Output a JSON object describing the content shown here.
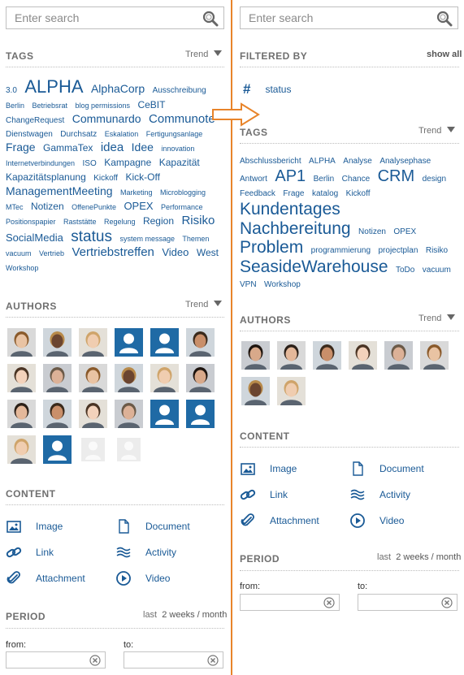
{
  "search": {
    "placeholder": "Enter search"
  },
  "left": {
    "tags_title": "TAGS",
    "trend_label": "Trend",
    "tags": [
      [
        "3.0",
        10
      ],
      [
        "ALPHA",
        22
      ],
      [
        "AlphaCorp",
        14
      ],
      [
        "Ausschreibung",
        10
      ],
      [
        "Berlin",
        9
      ],
      [
        "Betriebsrat",
        9
      ],
      [
        "blog permissions",
        9
      ],
      [
        "CeBIT",
        12
      ],
      [
        "ChangeRequest",
        10
      ],
      [
        "Communardo",
        14
      ],
      [
        "Communote",
        15
      ],
      [
        "Dienstwagen",
        10
      ],
      [
        "Durchsatz",
        10
      ],
      [
        "Eskalation",
        9
      ],
      [
        "Fertigungsanlage",
        9
      ],
      [
        "Frage",
        14
      ],
      [
        "GammaTex",
        12
      ],
      [
        "idea",
        15
      ],
      [
        "Idee",
        14
      ],
      [
        "innovation",
        9
      ],
      [
        "Internetverbindungen",
        9
      ],
      [
        "ISO",
        10
      ],
      [
        "Kampagne",
        12
      ],
      [
        "Kapazität",
        12
      ],
      [
        "Kapazitätsplanung",
        12
      ],
      [
        "Kickoff",
        10
      ],
      [
        "Kick-Off",
        12
      ],
      [
        "ManagementMeeting",
        14
      ],
      [
        "Marketing",
        9
      ],
      [
        "Microblogging",
        9
      ],
      [
        "MTec",
        9
      ],
      [
        "Notizen",
        12
      ],
      [
        "OffenePunkte",
        9
      ],
      [
        "OPEX",
        13
      ],
      [
        "Performance",
        9
      ],
      [
        "Positionspapier",
        9
      ],
      [
        "Raststätte",
        9
      ],
      [
        "Regelung",
        9
      ],
      [
        "Region",
        12
      ],
      [
        "Risiko",
        15
      ],
      [
        "SocialMedia",
        13
      ],
      [
        "status",
        19
      ],
      [
        "system message",
        9
      ],
      [
        "Themen",
        9
      ],
      [
        "vacuum",
        9
      ],
      [
        "Vertrieb",
        9
      ],
      [
        "Vertriebstreffen",
        15
      ],
      [
        "Video",
        13
      ],
      [
        "West",
        12
      ],
      [
        "Workshop",
        9
      ]
    ],
    "authors_title": "AUTHORS",
    "authors_trend": "Trend",
    "authors": [
      "photo",
      "photo",
      "photo",
      "placeholder",
      "placeholder",
      "photo",
      "photo",
      "photo",
      "photo",
      "photo",
      "photo",
      "photo",
      "photo",
      "photo",
      "photo",
      "photo",
      "placeholder",
      "placeholder",
      "photo",
      "placeholder",
      "blank",
      "blank"
    ],
    "content_title": "CONTENT",
    "content": [
      {
        "label": "Image",
        "icon": "image-icon"
      },
      {
        "label": "Document",
        "icon": "document-icon"
      },
      {
        "label": "Link",
        "icon": "link-icon"
      },
      {
        "label": "Activity",
        "icon": "activity-icon"
      },
      {
        "label": "Attachment",
        "icon": "attachment-icon"
      },
      {
        "label": "Video",
        "icon": "video-icon"
      }
    ],
    "period_title": "PERIOD",
    "period_last": "last",
    "period_range": "2 weeks / month",
    "from_label": "from:",
    "to_label": "to:"
  },
  "right": {
    "filtered_title": "FILTERED BY",
    "show_all": "show all",
    "filter_symbol": "#",
    "filter_value": "status",
    "tags_title": "TAGS",
    "trend_label": "Trend",
    "tags": [
      [
        "Abschlussbericht",
        10
      ],
      [
        "ALPHA",
        10
      ],
      [
        "Analyse",
        10
      ],
      [
        "Analysephase",
        10
      ],
      [
        "Antwort",
        10
      ],
      [
        "AP1",
        20
      ],
      [
        "Berlin",
        10
      ],
      [
        "Chance",
        10
      ],
      [
        "CRM",
        20
      ],
      [
        "design",
        10
      ],
      [
        "Feedback",
        10
      ],
      [
        "Frage",
        10
      ],
      [
        "katalog",
        10
      ],
      [
        "Kickoff",
        10
      ],
      [
        "Kundentages",
        21
      ],
      [
        "Nachbereitung",
        21
      ],
      [
        "Notizen",
        10
      ],
      [
        "OPEX",
        10
      ],
      [
        "Problem",
        21
      ],
      [
        "programmierung",
        10
      ],
      [
        "projectplan",
        10
      ],
      [
        "Risiko",
        10
      ],
      [
        "SeasideWarehouse",
        21
      ],
      [
        "ToDo",
        10
      ],
      [
        "vacuum",
        10
      ],
      [
        "VPN",
        10
      ],
      [
        "Workshop",
        10
      ]
    ],
    "authors_title": "AUTHORS",
    "authors_trend": "Trend",
    "authors": [
      "photo",
      "photo",
      "photo",
      "photo",
      "photo",
      "photo",
      "photo",
      "photo"
    ],
    "content_title": "CONTENT",
    "content": [
      {
        "label": "Image",
        "icon": "image-icon"
      },
      {
        "label": "Document",
        "icon": "document-icon"
      },
      {
        "label": "Link",
        "icon": "link-icon"
      },
      {
        "label": "Activity",
        "icon": "activity-icon"
      },
      {
        "label": "Attachment",
        "icon": "attachment-icon"
      },
      {
        "label": "Video",
        "icon": "video-icon"
      }
    ],
    "period_title": "PERIOD",
    "period_last": "last",
    "period_range": "2 weeks / month",
    "from_label": "from:",
    "to_label": "to:"
  },
  "colors": {
    "accent": "#1a5a96",
    "divider": "#e8842a",
    "placeholder_avatar": "#1f6aa5"
  }
}
